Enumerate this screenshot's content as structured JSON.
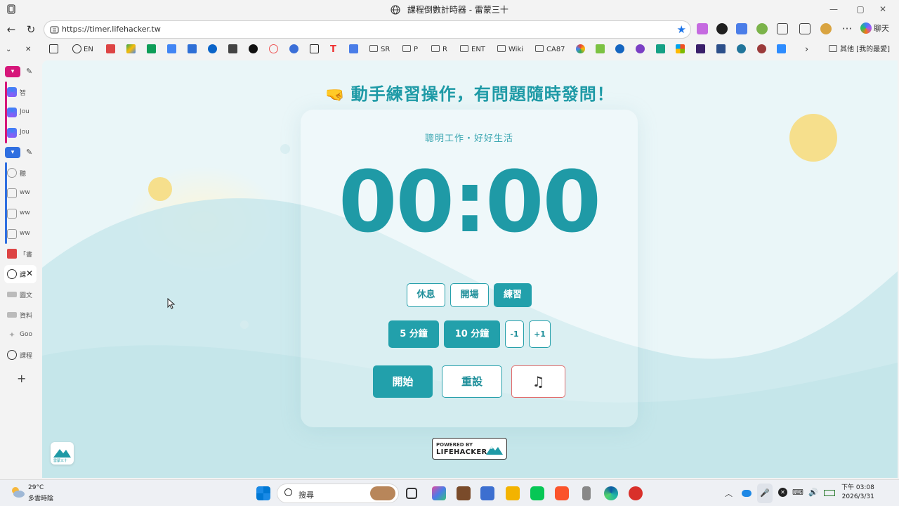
{
  "window": {
    "title": "課程倒數計時器 - 雷蒙三十",
    "controls": {
      "minimize": "—",
      "maximize": "▢",
      "close": "✕"
    }
  },
  "addressbar": {
    "url": "https://timer.lifehacker.tw",
    "profile_label": "聊天"
  },
  "bookmarks": {
    "items": [
      "EN",
      "SR",
      "P",
      "R",
      "ENT",
      "Wiki",
      "CA87"
    ],
    "other_folder": "其他 [我的最愛]"
  },
  "sidebar_tabs": {
    "group1": [
      "智",
      "Jou",
      "Jou"
    ],
    "group2": [
      "聽",
      "ww",
      "ww",
      "ww"
    ],
    "others": [
      "「書",
      "課",
      "圖文",
      "資料",
      "Goo",
      "課程"
    ],
    "new_tab": "+"
  },
  "page": {
    "heading": "動手練習操作，有問題隨時發問！",
    "slogan": "聰明工作・好好生活",
    "time": "00:00",
    "modes": [
      "休息",
      "開場",
      "練習"
    ],
    "presets": [
      "5 分鐘",
      "10 分鐘"
    ],
    "adjust": [
      "-1",
      "+1"
    ],
    "start_label": "開始",
    "reset_label": "重設",
    "music_icon": "♫",
    "powered_by": "POWERED BY",
    "powered_brand": "LIFEHACKER",
    "logo_text": "雷蒙三十"
  },
  "taskbar": {
    "weather_temp": "29°C",
    "weather_desc": "多雲時陰",
    "search_label": "搜尋",
    "time_line": "下午 03:08",
    "date_line": "2026/3/31"
  },
  "colors": {
    "accent": "#22a0ab",
    "background": "#eaf6f8",
    "music_border": "#e26b6b"
  }
}
